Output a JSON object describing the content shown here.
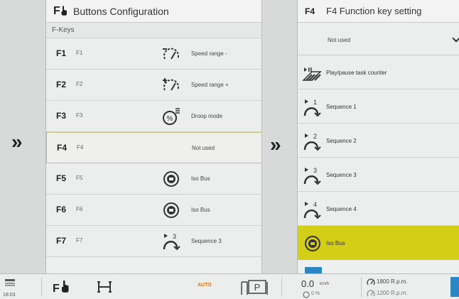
{
  "left": {
    "title": "Buttons Configuration",
    "subheader": "F-Keys",
    "rows": [
      {
        "key": "F1",
        "num": "F1",
        "label": "Speed range -",
        "icon": "speed-range-minus-icon"
      },
      {
        "key": "F2",
        "num": "F2",
        "label": "Speed range +",
        "icon": "speed-range-plus-icon"
      },
      {
        "key": "F3",
        "num": "F3",
        "label": "Droop mode",
        "icon": "droop-mode-icon"
      },
      {
        "key": "F4",
        "num": "F4",
        "label": "Not used",
        "icon": ""
      },
      {
        "key": "F5",
        "num": "F5",
        "label": "Iso Bus",
        "icon": "iso-bus-icon"
      },
      {
        "key": "F6",
        "num": "F6",
        "label": "Iso Bus",
        "icon": "iso-bus-icon"
      },
      {
        "key": "F7",
        "num": "F7",
        "label": "Sequence 3",
        "icon": "sequence-3-icon"
      }
    ]
  },
  "right": {
    "fkey": "F4",
    "title": "F4 Function key setting",
    "dropdown_value": "Not used",
    "options": [
      {
        "label": "Play/pause task counter",
        "icon": "play-pause-counter-icon"
      },
      {
        "label": "Sequence 1",
        "icon": "sequence-1-icon",
        "n": "1"
      },
      {
        "label": "Sequence 2",
        "icon": "sequence-2-icon",
        "n": "2"
      },
      {
        "label": "Sequence 3",
        "icon": "sequence-3-icon",
        "n": "3"
      },
      {
        "label": "Sequence 4",
        "icon": "sequence-4-icon",
        "n": "4"
      },
      {
        "label": "Iso Bus",
        "icon": "iso-bus-icon"
      }
    ]
  },
  "statusbar": {
    "time": "18:03",
    "auto": "AUTO",
    "speed": "0.0",
    "speed_unit": "km/h",
    "speed_sub": "0 %",
    "rpm": "1800 R.p.m.",
    "rpm_sub": "1200 R.p.m."
  },
  "colors": {
    "selected_option": "#d4ce17",
    "selected_row_border": "#c3c27e",
    "accent_blue": "#2a86c4",
    "auto_orange": "#e0700f"
  }
}
